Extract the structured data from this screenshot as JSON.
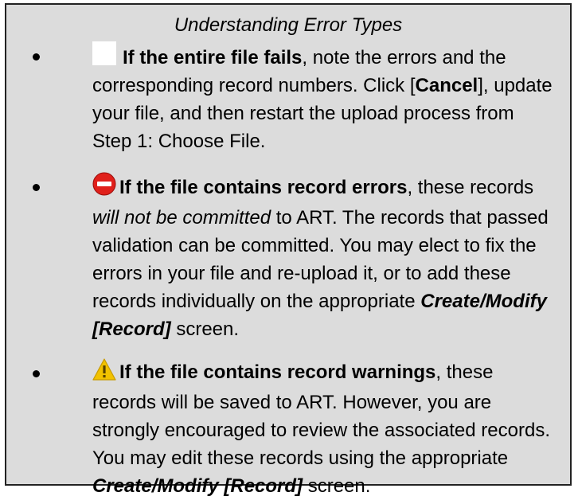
{
  "title": "Understanding Error Types",
  "items": [
    {
      "icon": "blank-file-icon",
      "lead": "If the entire file fails",
      "text_a": ", note the errors and the corresponding record numbers. Click [",
      "button": "Cancel",
      "text_b": "], update your file, and then restart the upload process from Step 1: Choose File."
    },
    {
      "icon": "no-entry-icon",
      "icon_color": "#e0201b",
      "lead": "If the file contains record errors",
      "text_a": ", these records ",
      "emph": "will not be committed",
      "text_b": " to ART. The records that passed validation can be committed. You may elect to fix the errors in your file and re-upload it, or to add these records individually on the appropriate ",
      "screen": "Create/Modify [Record]",
      "text_c": " screen."
    },
    {
      "icon": "warning-icon",
      "icon_color": "#f2c200",
      "lead": "If the file contains record warnings",
      "text_a": ", these records will be saved to ART. However, you are strongly encouraged to review the associated records. You may edit these records using the appropriate ",
      "screen": "Create/Modify [Record]",
      "text_b": " screen."
    }
  ]
}
